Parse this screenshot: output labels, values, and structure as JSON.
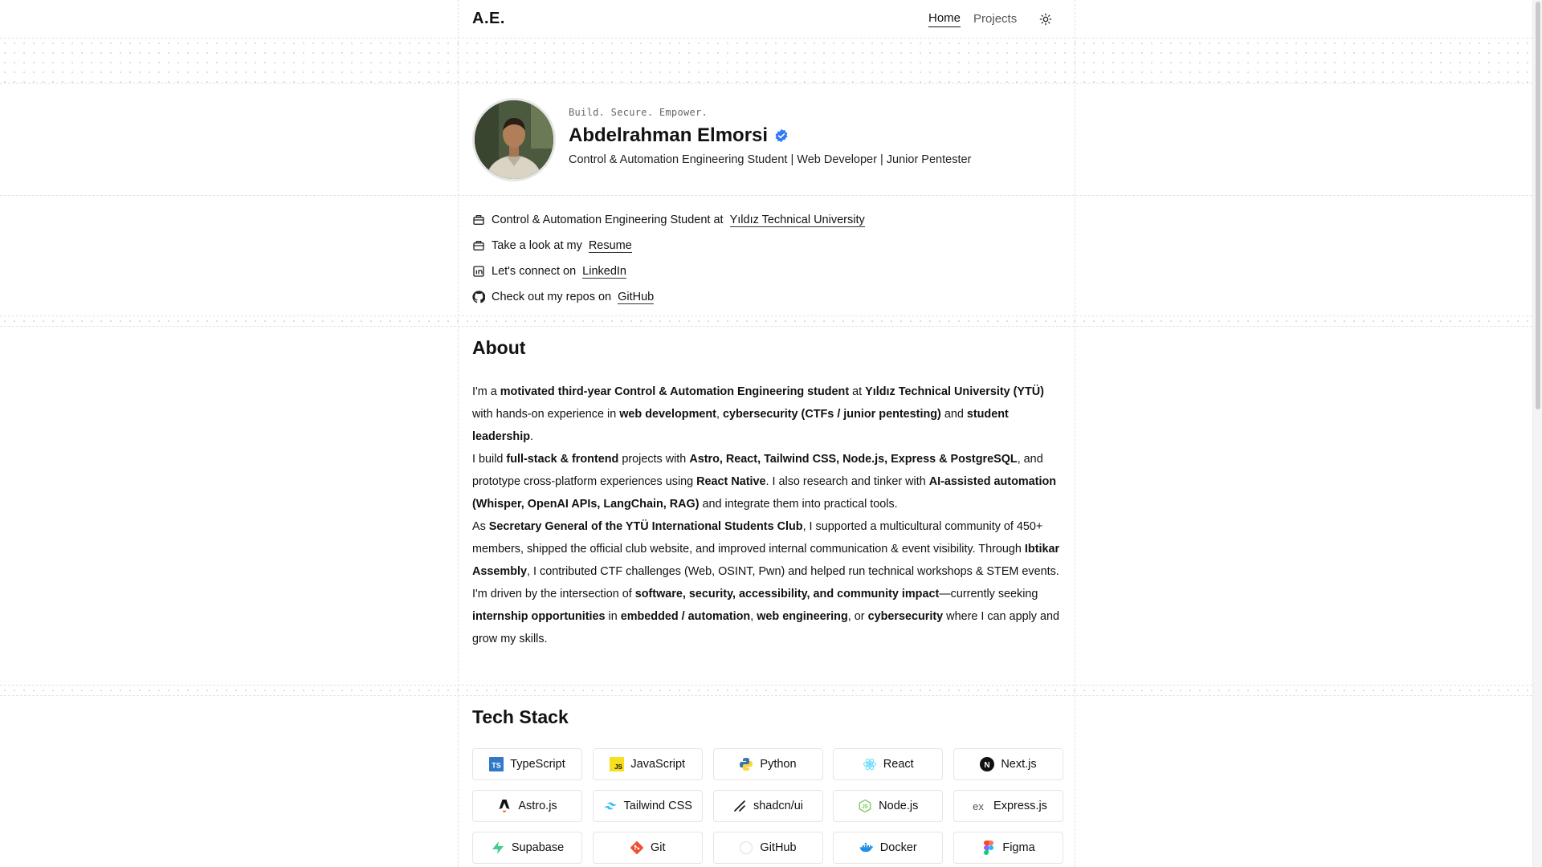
{
  "header": {
    "brand": "A.E.",
    "nav": [
      {
        "label": "Home",
        "active": true
      },
      {
        "label": "Projects",
        "active": false
      }
    ],
    "theme_toggle_icon": "sun-icon"
  },
  "profile": {
    "tagline": "Build. Secure. Empower.",
    "name": "Abdelrahman Elmorsi",
    "verified_icon": "verified-badge-icon",
    "subtitle": "Control & Automation Engineering Student | Web Developer | Junior Pentester"
  },
  "info": [
    {
      "icon": "briefcase-icon",
      "text": "Control & Automation Engineering Student at",
      "link": "Yıldız Technical University"
    },
    {
      "icon": "briefcase-icon",
      "text": "Take a look at my",
      "link": "Resume"
    },
    {
      "icon": "linkedin-icon",
      "text": "Let's connect on",
      "link": "LinkedIn"
    },
    {
      "icon": "github-icon",
      "text": "Check out my repos on",
      "link": "GitHub"
    }
  ],
  "about": {
    "heading": "About",
    "p1": [
      {
        "t": "I'm a ",
        "b": false
      },
      {
        "t": "motivated third-year Control & Automation Engineering student",
        "b": true
      },
      {
        "t": " at ",
        "b": false
      },
      {
        "t": "Yıldız Technical University (YTÜ)",
        "b": true
      },
      {
        "t": " with hands-on experience in ",
        "b": false
      },
      {
        "t": "web development",
        "b": true
      },
      {
        "t": ", ",
        "b": false
      },
      {
        "t": "cybersecurity (CTFs / junior pentesting)",
        "b": true
      },
      {
        "t": " and ",
        "b": false
      },
      {
        "t": "student leadership",
        "b": true
      },
      {
        "t": ".",
        "b": false
      }
    ],
    "p2": [
      {
        "t": "I build ",
        "b": false
      },
      {
        "t": "full-stack & frontend",
        "b": true
      },
      {
        "t": " projects with ",
        "b": false
      },
      {
        "t": "Astro, React, Tailwind CSS, Node.js, Express & PostgreSQL",
        "b": true
      },
      {
        "t": ", and prototype cross-platform experiences using ",
        "b": false
      },
      {
        "t": "React Native",
        "b": true
      },
      {
        "t": ". I also research and tinker with ",
        "b": false
      },
      {
        "t": "AI-assisted automation (Whisper, OpenAI APIs, LangChain, RAG)",
        "b": true
      },
      {
        "t": " and integrate them into practical tools.",
        "b": false
      }
    ],
    "p3": [
      {
        "t": "As ",
        "b": false
      },
      {
        "t": "Secretary General of the YTÜ International Students Club",
        "b": true
      },
      {
        "t": ", I supported a multicultural community of 450+ members, shipped the official club website, and improved internal communication & event visibility. Through ",
        "b": false
      },
      {
        "t": "Ibtikar Assembly",
        "b": true
      },
      {
        "t": ", I contributed CTF challenges (Web, OSINT, Pwn) and helped run technical workshops & STEM events.",
        "b": false
      }
    ],
    "p4": [
      {
        "t": "I'm driven by the intersection of ",
        "b": false
      },
      {
        "t": "software, security, accessibility, and community impact",
        "b": true
      },
      {
        "t": "—currently seeking ",
        "b": false
      },
      {
        "t": "internship opportunities",
        "b": true
      },
      {
        "t": " in ",
        "b": false
      },
      {
        "t": "embedded / automation",
        "b": true
      },
      {
        "t": ", ",
        "b": false
      },
      {
        "t": "web engineering",
        "b": true
      },
      {
        "t": ", or ",
        "b": false
      },
      {
        "t": "cybersecurity",
        "b": true
      },
      {
        "t": " where I can apply and grow my skills.",
        "b": false
      }
    ]
  },
  "tech": {
    "heading": "Tech Stack",
    "items": [
      {
        "label": "TypeScript",
        "icon": "typescript-icon"
      },
      {
        "label": "JavaScript",
        "icon": "javascript-icon"
      },
      {
        "label": "Python",
        "icon": "python-icon"
      },
      {
        "label": "React",
        "icon": "react-icon"
      },
      {
        "label": "Next.js",
        "icon": "nextjs-icon"
      },
      {
        "label": "Astro.js",
        "icon": "astro-icon"
      },
      {
        "label": "Tailwind CSS",
        "icon": "tailwind-icon"
      },
      {
        "label": "shadcn/ui",
        "icon": "shadcn-icon"
      },
      {
        "label": "Node.js",
        "icon": "nodejs-icon"
      },
      {
        "label": "Express.js",
        "icon": "express-icon"
      },
      {
        "label": "Supabase",
        "icon": "supabase-icon"
      },
      {
        "label": "Git",
        "icon": "git-icon"
      },
      {
        "label": "GitHub",
        "icon": "github-icon"
      },
      {
        "label": "Docker",
        "icon": "docker-icon"
      },
      {
        "label": "Figma",
        "icon": "figma-icon"
      }
    ]
  }
}
